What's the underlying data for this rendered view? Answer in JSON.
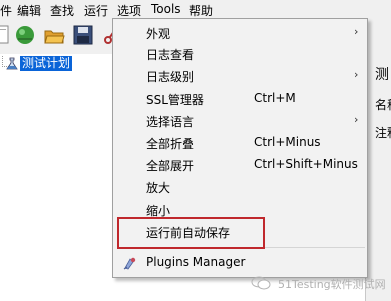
{
  "menubar": {
    "items": [
      "件",
      "编辑",
      "查找",
      "运行",
      "选项",
      "Tools",
      "帮助"
    ]
  },
  "tree": {
    "root_label": "测试计划"
  },
  "right_pane": {
    "text_1": "测",
    "text_2": "名称",
    "text_3": "注释"
  },
  "options_menu": {
    "items": [
      {
        "label": "外观",
        "shortcut": "",
        "submenu": true
      },
      {
        "label": "日志查看",
        "shortcut": "",
        "submenu": false
      },
      {
        "label": "日志级别",
        "shortcut": "",
        "submenu": true
      },
      {
        "label": "SSL管理器",
        "shortcut": "Ctrl+M",
        "submenu": false
      },
      {
        "label": "选择语言",
        "shortcut": "",
        "submenu": true
      },
      {
        "label": "全部折叠",
        "shortcut": "Ctrl+Minus",
        "submenu": false
      },
      {
        "label": "全部展开",
        "shortcut": "Ctrl+Shift+Minus",
        "submenu": false
      },
      {
        "label": "放大",
        "shortcut": "",
        "submenu": false
      },
      {
        "label": "缩小",
        "shortcut": "",
        "submenu": false
      },
      {
        "label": "运行前自动保存",
        "shortcut": "",
        "submenu": false
      },
      {
        "label": "Plugins Manager",
        "shortcut": "",
        "submenu": false
      }
    ],
    "submenu_arrow": "›"
  },
  "watermark": {
    "text": "51Testing软件测试网"
  },
  "colors": {
    "selection": "#0a64d8",
    "highlight_box": "#c0282d",
    "menu_bg": "#f2f2f2"
  },
  "icons": [
    "new-file-icon",
    "templates-icon",
    "open-icon",
    "save-icon",
    "cut-icon",
    "plugin-icon",
    "wechat-icon",
    "test-plan-icon"
  ]
}
